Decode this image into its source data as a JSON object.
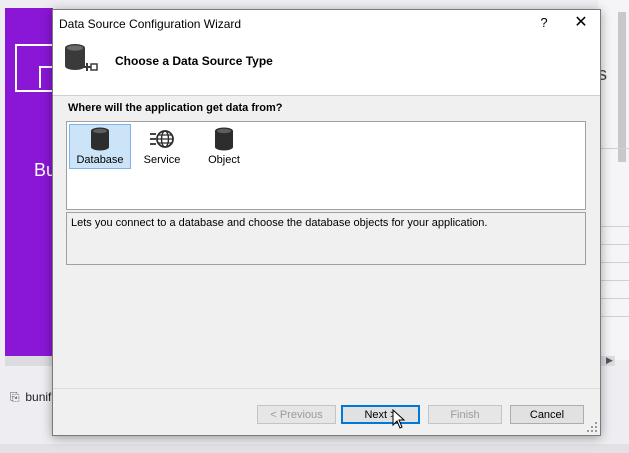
{
  "background": {
    "brand_text": "Bu",
    "right_fragment": "s",
    "bottom_item": "bunifi"
  },
  "dialog": {
    "title": "Data Source Configuration Wizard",
    "help_glyph": "?",
    "close_glyph": "✕",
    "header_title": "Choose a Data Source Type",
    "question": "Where will the application get data from?",
    "types": [
      {
        "label": "Database",
        "icon": "database-icon",
        "selected": true
      },
      {
        "label": "Service",
        "icon": "service-icon",
        "selected": false
      },
      {
        "label": "Object",
        "icon": "object-icon",
        "selected": false
      }
    ],
    "description": "Lets you connect to a database and choose the database objects for your application.",
    "buttons": {
      "previous": "< Previous",
      "next": "Next >",
      "finish": "Finish",
      "cancel": "Cancel"
    }
  },
  "colors": {
    "accent": "#0078d7",
    "selection": "#cce4f7",
    "brand_purple": "#8a16d6"
  }
}
